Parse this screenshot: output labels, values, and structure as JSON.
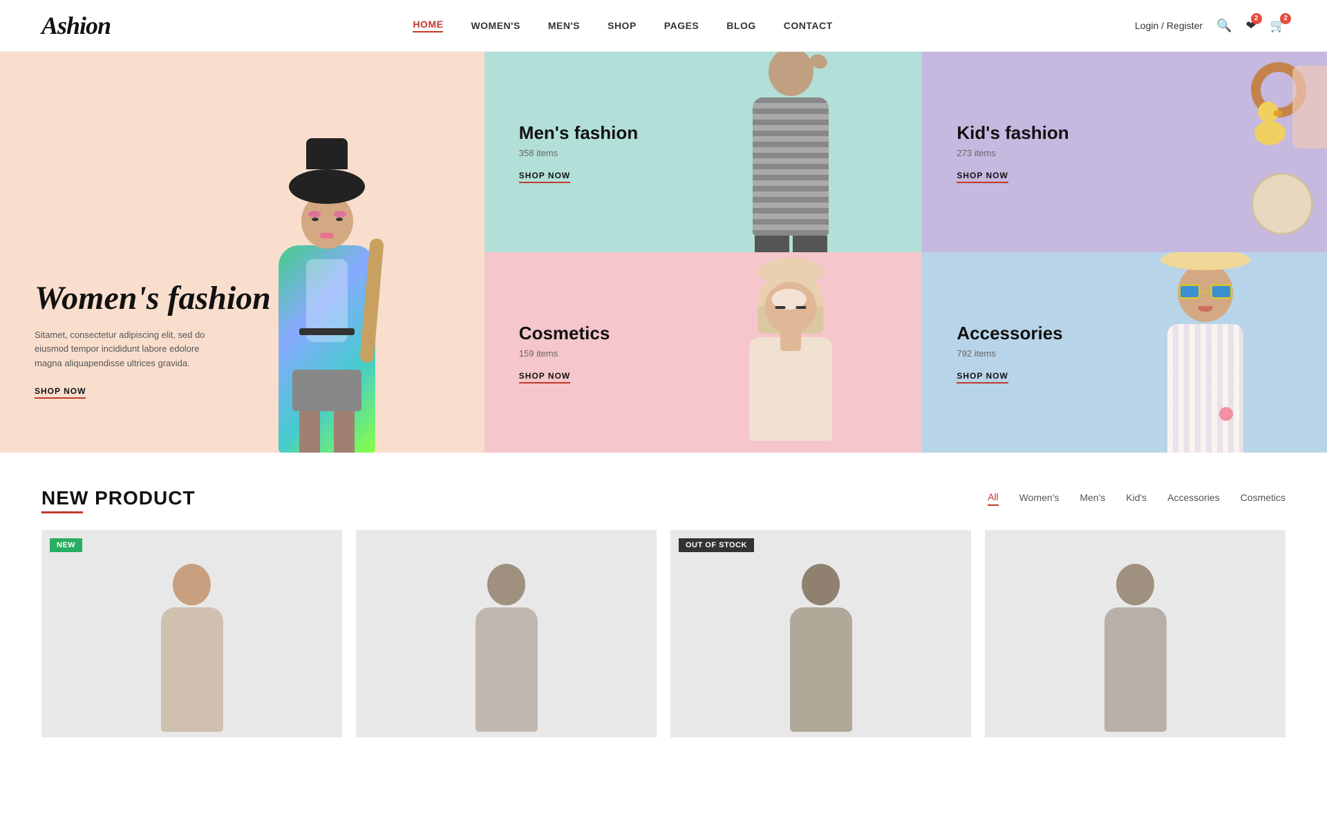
{
  "header": {
    "logo": "Ashion",
    "nav": [
      {
        "label": "HOME",
        "active": true
      },
      {
        "label": "WOMEN'S",
        "active": false
      },
      {
        "label": "MEN'S",
        "active": false
      },
      {
        "label": "SHOP",
        "active": false
      },
      {
        "label": "PAGES",
        "active": false
      },
      {
        "label": "BLOG",
        "active": false
      },
      {
        "label": "CONTACT",
        "active": false
      }
    ],
    "login_label": "Login / Register",
    "wishlist_count": "2",
    "cart_count": "2"
  },
  "hero": {
    "women": {
      "title": "Women's fashion",
      "description": "Sitamet, consectetur adipiscing elit, sed do eiusmod tempor incididunt labore edolore magna aliquapendisse ultrices gravida.",
      "shop_now": "SHOP NOW",
      "bg_color": "#f9dece"
    },
    "men": {
      "title": "Men's fashion",
      "count": "358 items",
      "shop_now": "SHOP NOW",
      "bg_color": "#b2e0d8"
    },
    "kids": {
      "title": "Kid's fashion",
      "count": "273 items",
      "shop_now": "SHOP NOW",
      "bg_color": "#c5b9e0"
    },
    "cosmetics": {
      "title": "Cosmetics",
      "count": "159 items",
      "shop_now": "SHOP NOW",
      "bg_color": "#f5c6cb"
    },
    "accessories": {
      "title": "Accessories",
      "count": "792 items",
      "shop_now": "SHOP NOW",
      "bg_color": "#b8d4e8"
    }
  },
  "new_product": {
    "title": "NEW PRODUCT",
    "filters": [
      {
        "label": "All",
        "active": true
      },
      {
        "label": "Women's",
        "active": false
      },
      {
        "label": "Men's",
        "active": false
      },
      {
        "label": "Kid's",
        "active": false
      },
      {
        "label": "Accessories",
        "active": false
      },
      {
        "label": "Cosmetics",
        "active": false
      }
    ],
    "products": [
      {
        "badge": "NEW",
        "badge_type": "new"
      },
      {
        "badge": "",
        "badge_type": ""
      },
      {
        "badge": "OUT OF STOCK",
        "badge_type": "out"
      },
      {
        "badge": "",
        "badge_type": ""
      }
    ]
  },
  "colors": {
    "accent": "#c0392b",
    "women_bg": "#f9dece",
    "men_bg": "#b2e0d8",
    "kids_bg": "#c5b9e0",
    "cosmetics_bg": "#f5c6cb",
    "accessories_bg": "#b8d4e8"
  }
}
